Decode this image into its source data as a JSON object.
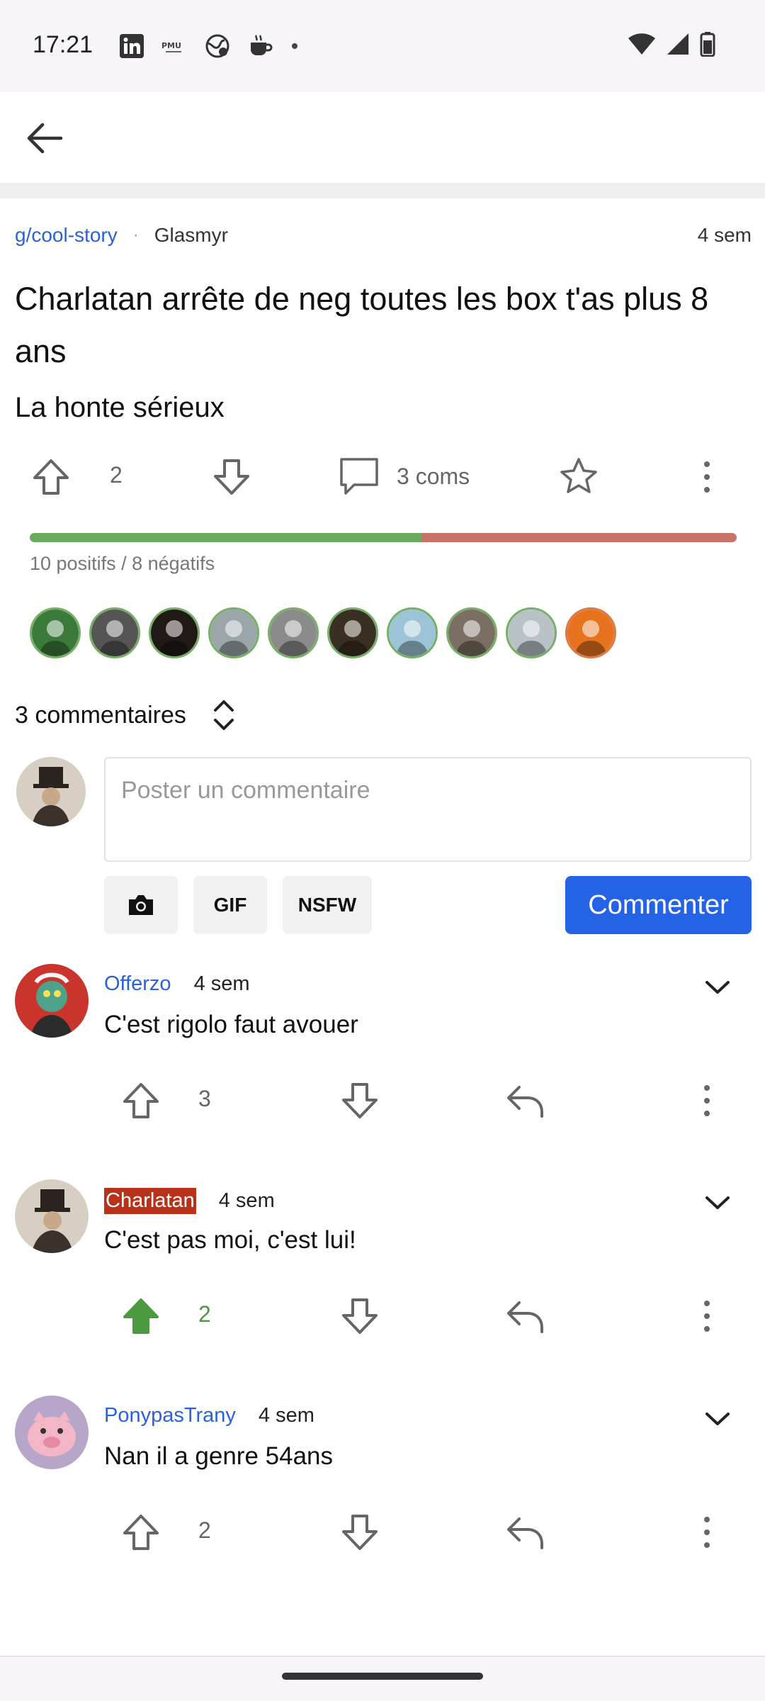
{
  "status_bar": {
    "time": "17:21",
    "left_icons": [
      "linkedin-icon",
      "pmu-icon",
      "globe-icon",
      "coffee-icon",
      "dot-icon"
    ],
    "right_icons": [
      "wifi-icon",
      "signal-icon",
      "battery-icon"
    ]
  },
  "app_bar": {
    "back_icon": "arrow-left-icon"
  },
  "post": {
    "group": "g/cool-story",
    "separator": "·",
    "author": "Glasmyr",
    "time": "4 sem",
    "title": "Charlatan arrête de neg toutes les box t'as plus 8 ans",
    "body": "La honte sérieux",
    "upvotes": "2",
    "comments_count": "3 coms",
    "vote_summary": "10 positifs / 8 négatifs",
    "positive_ratio": 0.5556,
    "colors": {
      "positive": "#6aab5e",
      "negative": "#c9726a",
      "link": "#2962d9",
      "primary": "#2463e6"
    }
  },
  "voters": [
    "#3b7a3a",
    "#555555",
    "#1f1a16",
    "#9aa6a8",
    "#8b8b8b",
    "#3a2f23",
    "#9cc3d6",
    "#7a6f62",
    "#b9c2c6",
    "#e7731f"
  ],
  "comments_header": {
    "label": "3 commentaires",
    "sort_icon": "chevron-up-down-icon"
  },
  "composer": {
    "placeholder": "Poster un commentaire",
    "camera_icon": "camera-icon",
    "gif_label": "GIF",
    "nsfw_label": "NSFW",
    "submit_label": "Commenter"
  },
  "comments": [
    {
      "user": "Offerzo",
      "time": "4 sem",
      "text": "C'est rigolo faut avouer",
      "votes": "3",
      "upvoted": false,
      "op": false
    },
    {
      "user": "Charlatan",
      "time": "4 sem",
      "text": "C'est pas moi, c'est lui!",
      "votes": "2",
      "upvoted": true,
      "op": true
    },
    {
      "user": "PonypasTrany",
      "time": "4 sem",
      "text": "Nan il a genre 54ans",
      "votes": "2",
      "upvoted": false,
      "op": false
    }
  ]
}
